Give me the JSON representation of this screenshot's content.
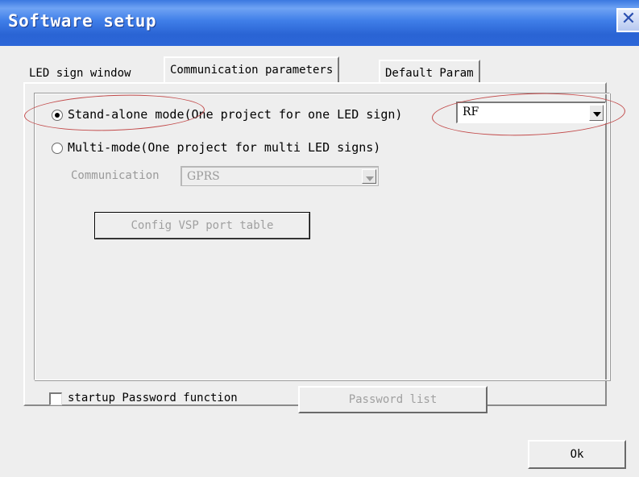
{
  "window": {
    "title": "Software setup",
    "close_glyph": "✕"
  },
  "tabs": [
    {
      "label": "LED sign window"
    },
    {
      "label": "Communication parameters",
      "active": true
    },
    {
      "label": "Default Param"
    }
  ],
  "standalone": {
    "label": "Stand-alone mode(One project for one LED sign)",
    "selected": true,
    "device_value": "RF"
  },
  "multimode": {
    "label": "Multi-mode(One project for multi LED signs)",
    "selected": false,
    "communication_label": "Communication",
    "communication_value": "GPRS",
    "config_button_label": "Config VSP port table"
  },
  "startup_password": {
    "label": "startup Password function",
    "checked": false
  },
  "password_list_label": "Password list",
  "ok_label": "Ok",
  "colors": {
    "titlebar": "#2a64d4",
    "annotation_circle": "#c24a4a",
    "disabled_text": "#9a9a9a"
  },
  "icons": {
    "close": "close-icon",
    "dropdown": "chevron-down-icon",
    "radio": "radio-dot-icon"
  }
}
